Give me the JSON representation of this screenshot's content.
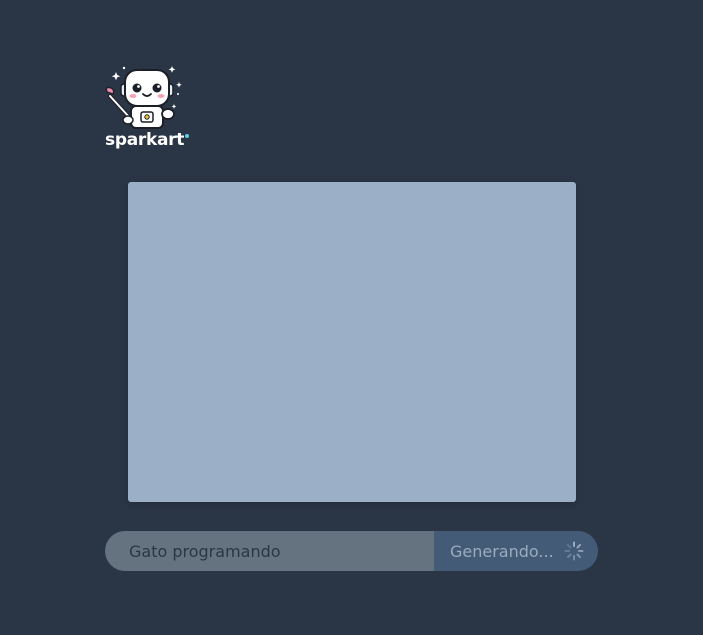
{
  "app": {
    "brand_name": "sparkart",
    "logo_icon": "robot-painter-icon",
    "background_color": "#2a3545"
  },
  "preview": {
    "placeholder_color": "#9bb0c7"
  },
  "prompt": {
    "value": "Gato programando",
    "generate_label": "Generando...",
    "status_icon": "spinner-icon"
  }
}
